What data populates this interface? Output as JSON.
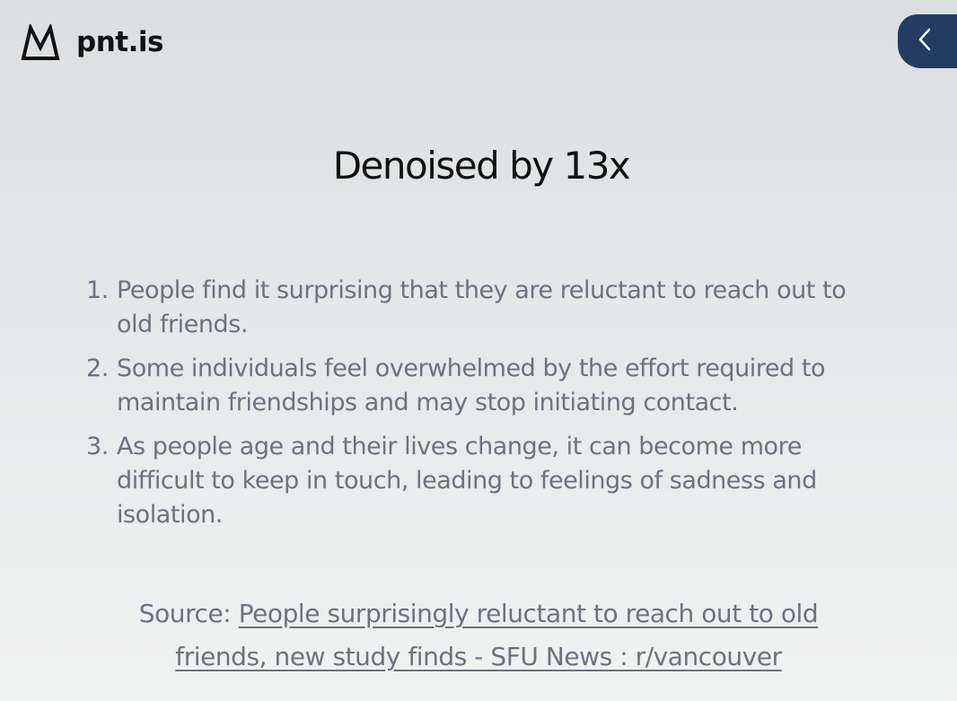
{
  "header": {
    "brand": "pnt.is",
    "logo_icon": "mountain-logo-icon",
    "back_icon": "chevron-left-icon"
  },
  "title": "Denoised by 13x",
  "points": [
    {
      "number": "1.",
      "text": "People find it surprising that they are reluctant to reach out to old friends."
    },
    {
      "number": "2.",
      "text": "Some individuals feel overwhelmed by the effort required to maintain friendships and may stop initiating contact."
    },
    {
      "number": "3.",
      "text": "As people age and their lives change, it can become more difficult to keep in touch, leading to feelings of sadness and isolation."
    }
  ],
  "source": {
    "label": "Source: ",
    "link_text": "People surprisingly reluctant to reach out to old friends, new study finds - SFU News : r/vancouver"
  },
  "colors": {
    "accent": "#233d62",
    "text": "#6b7280",
    "heading": "#111111"
  }
}
